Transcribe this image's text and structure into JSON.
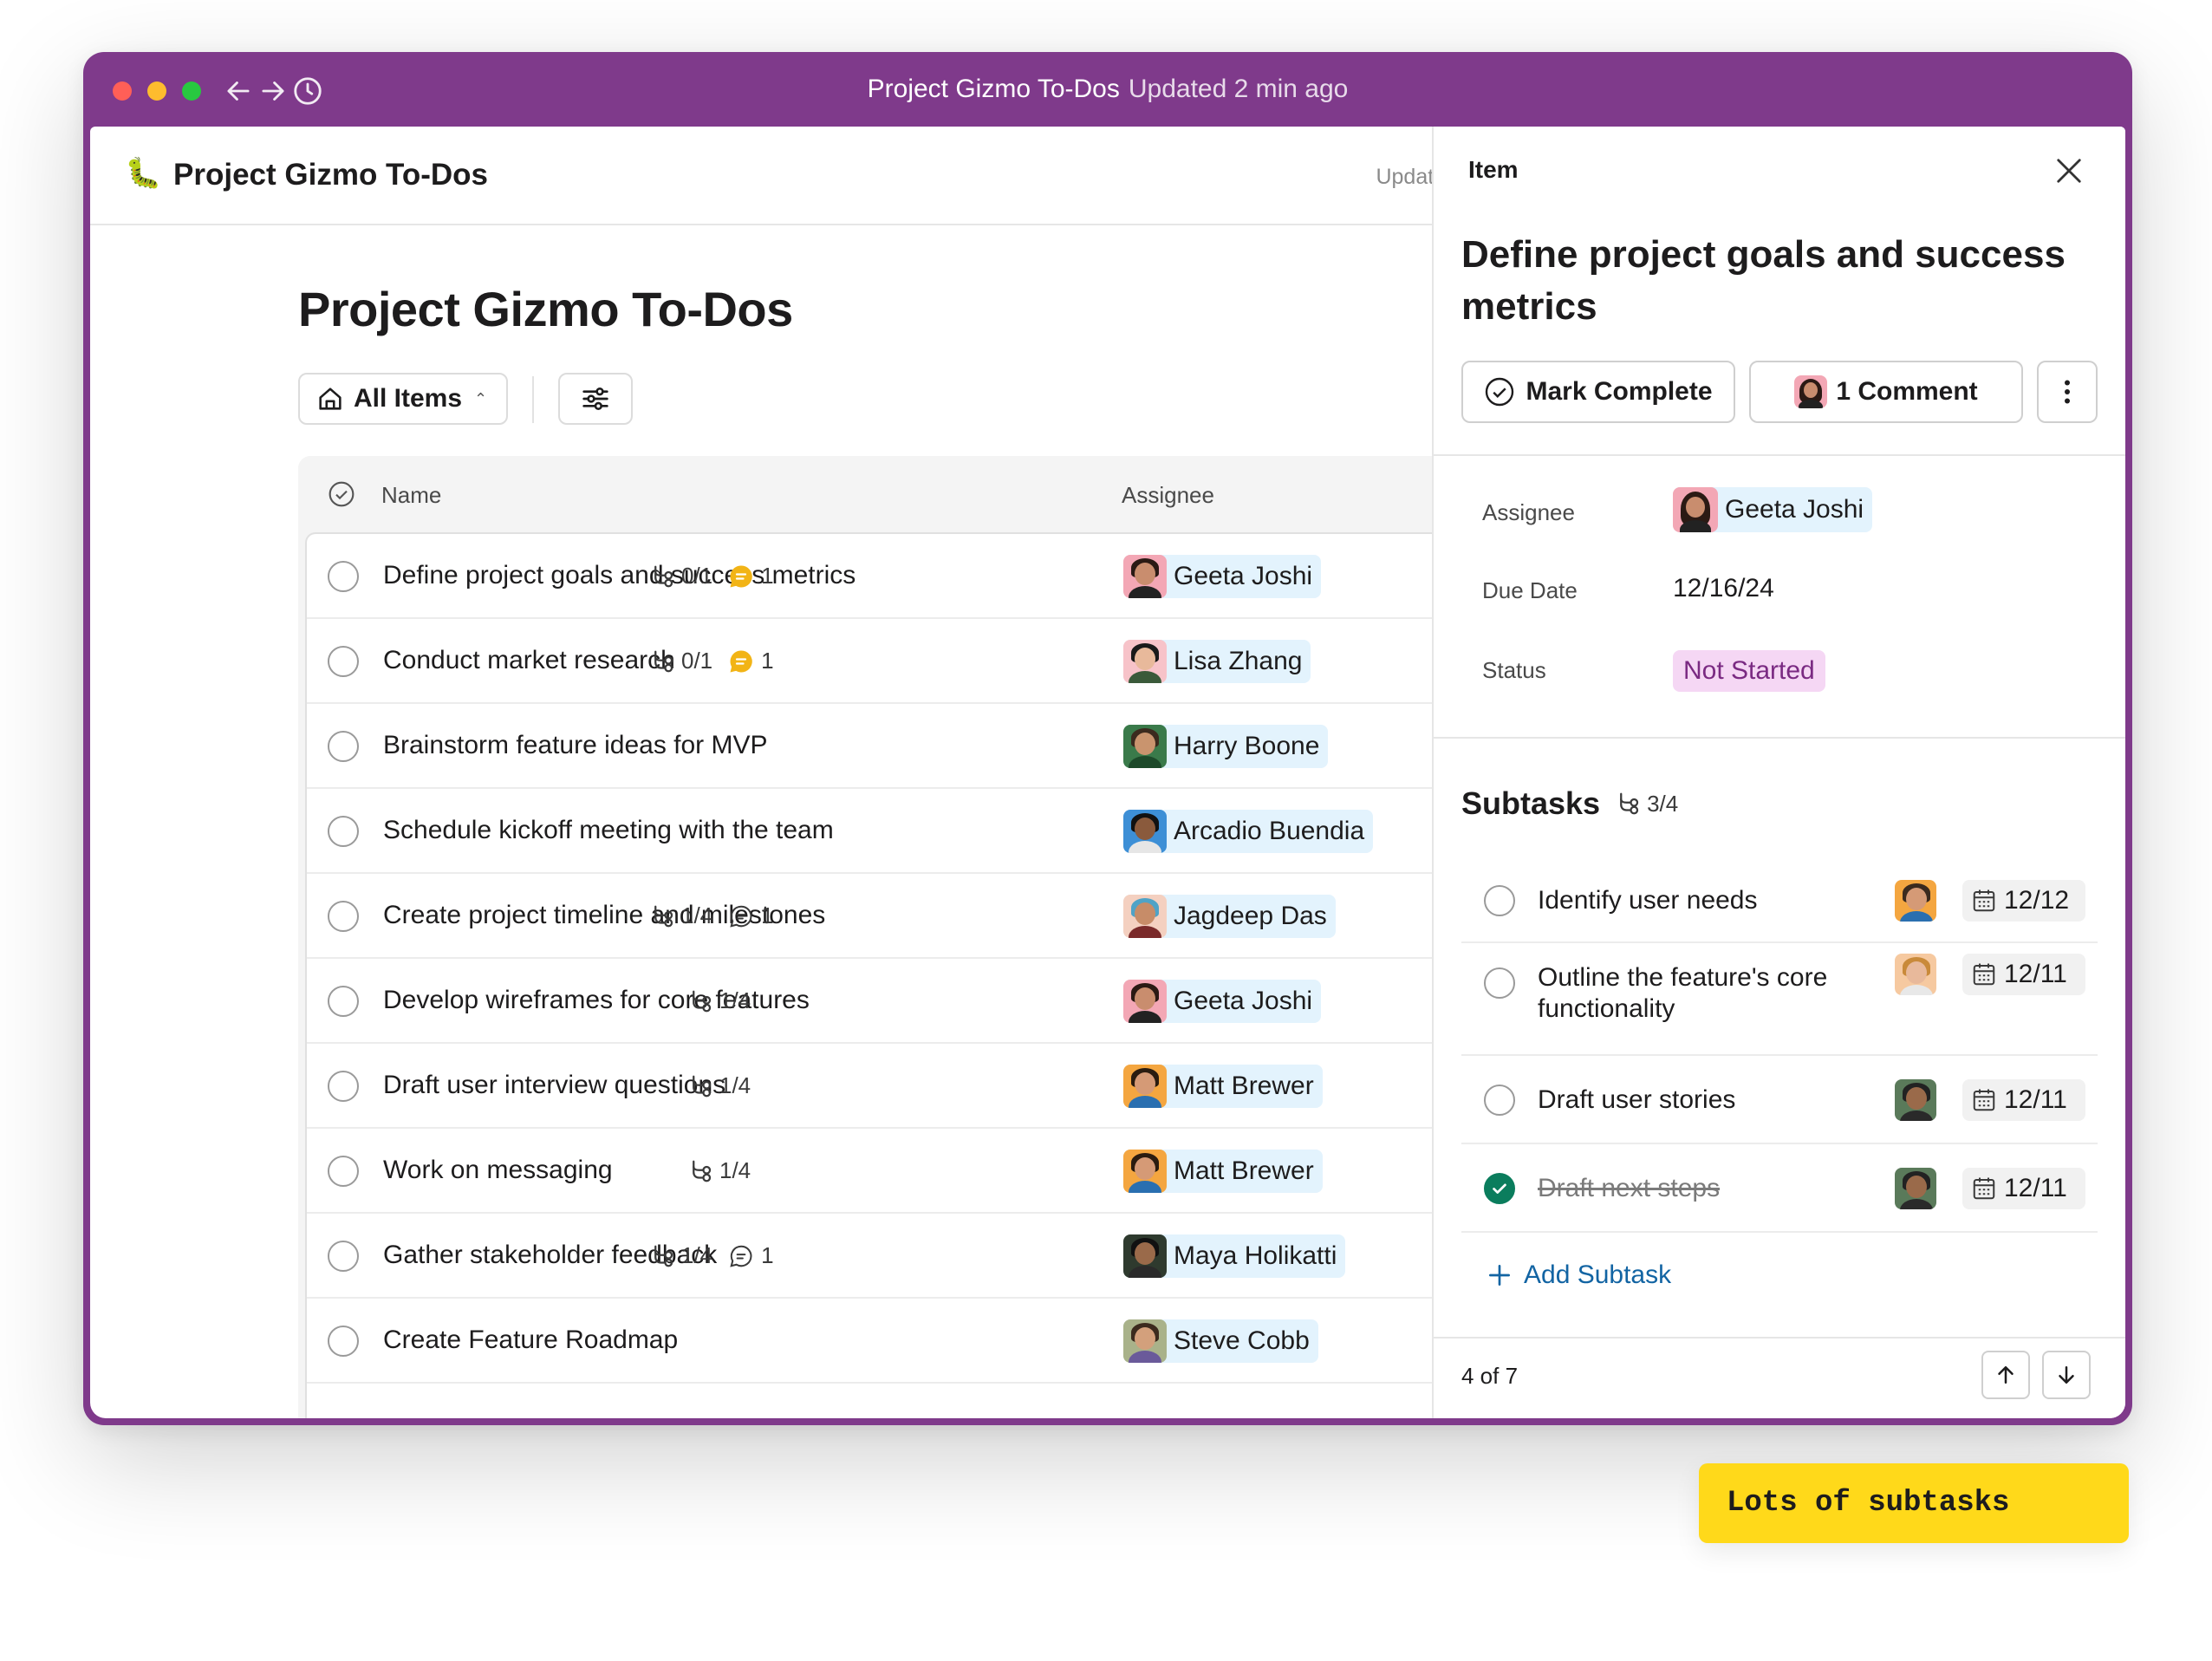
{
  "window": {
    "title": "Project Gizmo To-Dos",
    "subtitle": "Updated 2 min ago",
    "accent_color": "#7f3a8b"
  },
  "topbar": {
    "emoji": "🐛",
    "name": "Project Gizmo To-Dos",
    "updated": "Updated"
  },
  "main": {
    "heading": "Project Gizmo To-Dos",
    "view_select": "All Items"
  },
  "table": {
    "columns": {
      "name": "Name",
      "assignee": "Assignee"
    },
    "rows": [
      {
        "name": "Define project goals and success metrics",
        "subtasks": "0/1",
        "comments": "1",
        "comment_style": "badge",
        "assignee": "Geeta Joshi"
      },
      {
        "name": "Conduct market research",
        "subtasks": "0/1",
        "comments": "1",
        "comment_style": "badge",
        "assignee": "Lisa Zhang"
      },
      {
        "name": "Brainstorm feature ideas for MVP",
        "subtasks": "",
        "comments": "",
        "assignee": "Harry Boone"
      },
      {
        "name": "Schedule kickoff meeting with the team",
        "subtasks": "",
        "comments": "",
        "assignee": "Arcadio Buendia"
      },
      {
        "name": "Create project timeline and milestones",
        "subtasks": "1/4",
        "comments": "1",
        "comment_style": "outline",
        "assignee": "Jagdeep Das"
      },
      {
        "name": "Develop wireframes for core features",
        "subtasks": "1/4",
        "comments": "",
        "assignee": "Geeta Joshi"
      },
      {
        "name": "Draft user interview questions",
        "subtasks": "1/4",
        "comments": "",
        "assignee": "Matt Brewer"
      },
      {
        "name": "Work on messaging",
        "subtasks": "1/4",
        "comments": "",
        "assignee": "Matt Brewer"
      },
      {
        "name": "Gather stakeholder feedback",
        "subtasks": "1/4",
        "comments": "1",
        "comment_style": "outline",
        "assignee": "Maya Holikatti"
      },
      {
        "name": "Create Feature Roadmap",
        "subtasks": "",
        "comments": "",
        "assignee": "Steve Cobb"
      }
    ]
  },
  "panel": {
    "label": "Item",
    "title": "Define project goals and success metrics",
    "mark_complete": "Mark Complete",
    "comment_button": "1 Comment",
    "fields": {
      "assignee_label": "Assignee",
      "assignee": "Geeta Joshi",
      "due_label": "Due Date",
      "due": "12/16/24",
      "status_label": "Status",
      "status": "Not Started"
    },
    "subtasks_title": "Subtasks",
    "subtasks_count": "3/4",
    "subtasks": [
      {
        "text": "Identify user needs",
        "date": "12/12",
        "done": false
      },
      {
        "text": "Outline the feature's core functionality",
        "date": "12/11",
        "done": false
      },
      {
        "text": "Draft user stories",
        "date": "12/11",
        "done": false
      },
      {
        "text": "Draft next steps",
        "date": "12/11",
        "done": true
      }
    ],
    "add_subtask": "Add Subtask",
    "position": "4 of 7"
  },
  "callout": "Lots of subtasks"
}
